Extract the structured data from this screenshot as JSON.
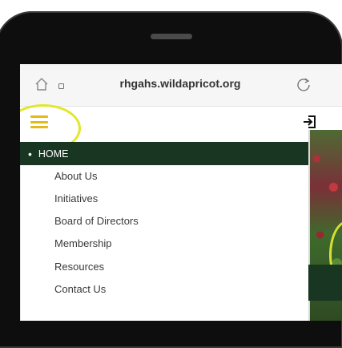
{
  "browser": {
    "url": "rhgahs.wildapricot.org"
  },
  "menu": {
    "home": {
      "bullet": "•",
      "label": "HOME"
    },
    "items": [
      {
        "label": "About Us"
      },
      {
        "label": "Initiatives"
      },
      {
        "label": "Board of Directors"
      },
      {
        "label": "Membership"
      },
      {
        "label": "Resources"
      },
      {
        "label": "Contact Us"
      }
    ]
  },
  "colors": {
    "menu_bar": "#183621",
    "hamburger": "#e0bb1a",
    "highlight_ring": "#e0e82a"
  },
  "icons": [
    "home-icon",
    "lock-icon",
    "reload-icon",
    "hamburger-menu-icon",
    "login-icon"
  ]
}
